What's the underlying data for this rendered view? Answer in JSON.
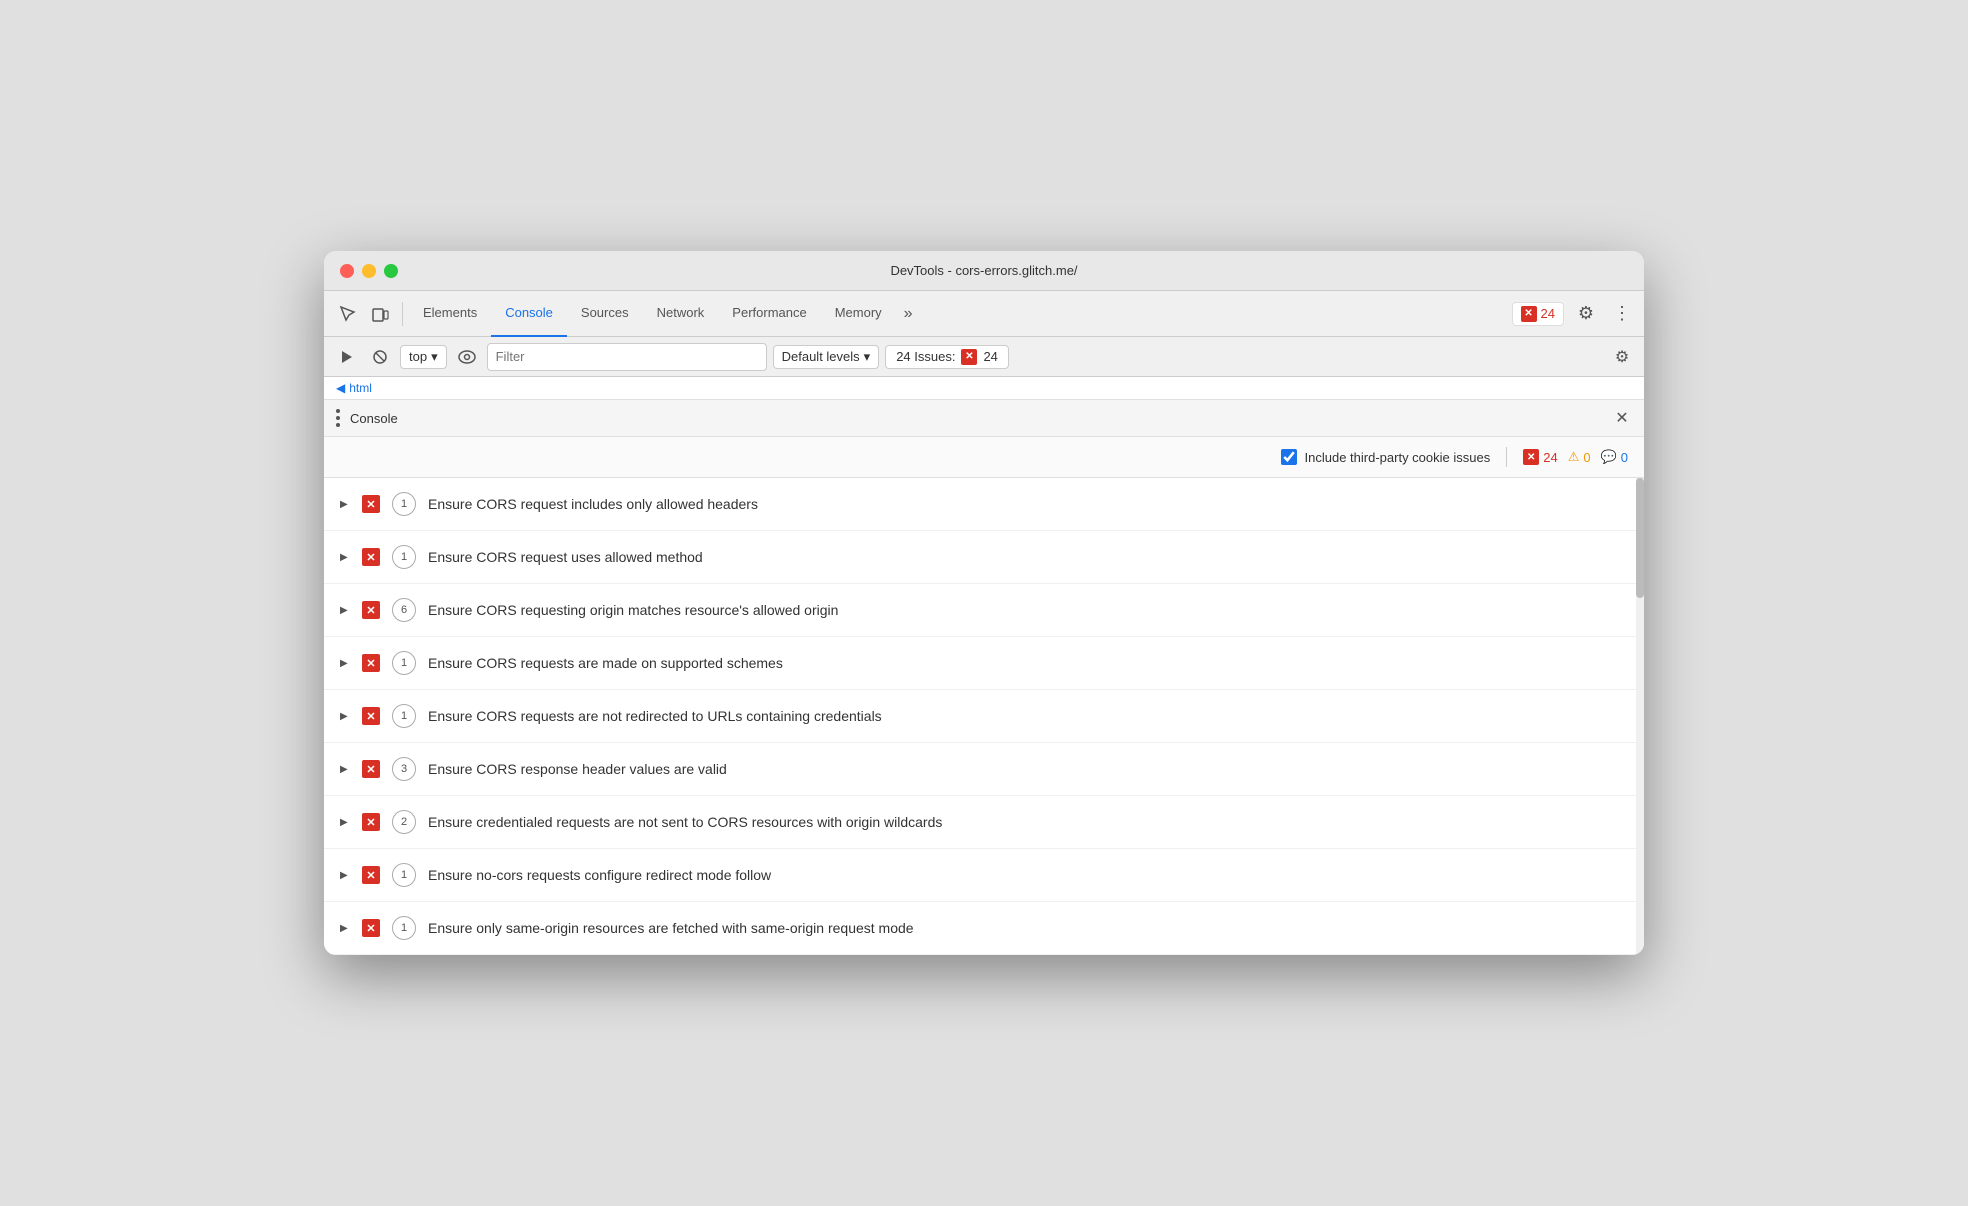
{
  "window": {
    "title": "DevTools - cors-errors.glitch.me/"
  },
  "toolbar": {
    "tabs": [
      {
        "id": "elements",
        "label": "Elements",
        "active": false
      },
      {
        "id": "console",
        "label": "Console",
        "active": true
      },
      {
        "id": "sources",
        "label": "Sources",
        "active": false
      },
      {
        "id": "network",
        "label": "Network",
        "active": false
      },
      {
        "id": "performance",
        "label": "Performance",
        "active": false
      },
      {
        "id": "memory",
        "label": "Memory",
        "active": false
      }
    ],
    "more_label": "»",
    "error_count": "24"
  },
  "console_toolbar": {
    "top_label": "top",
    "filter_placeholder": "Filter",
    "levels_label": "Default levels",
    "issues_label": "24 Issues:",
    "issues_count": "24"
  },
  "breadcrumb": {
    "text": "html"
  },
  "console_panel": {
    "title": "Console",
    "include_cookies_label": "Include third-party cookie issues",
    "counts": {
      "errors": "24",
      "warnings": "0",
      "info": "0"
    }
  },
  "issues": [
    {
      "id": 1,
      "count": 1,
      "text": "Ensure CORS request includes only allowed headers"
    },
    {
      "id": 2,
      "count": 1,
      "text": "Ensure CORS request uses allowed method"
    },
    {
      "id": 3,
      "count": 6,
      "text": "Ensure CORS requesting origin matches resource's allowed origin"
    },
    {
      "id": 4,
      "count": 1,
      "text": "Ensure CORS requests are made on supported schemes"
    },
    {
      "id": 5,
      "count": 1,
      "text": "Ensure CORS requests are not redirected to URLs containing credentials"
    },
    {
      "id": 6,
      "count": 3,
      "text": "Ensure CORS response header values are valid"
    },
    {
      "id": 7,
      "count": 2,
      "text": "Ensure credentialed requests are not sent to CORS resources with origin wildcards"
    },
    {
      "id": 8,
      "count": 1,
      "text": "Ensure no-cors requests configure redirect mode follow"
    },
    {
      "id": 9,
      "count": 1,
      "text": "Ensure only same-origin resources are fetched with same-origin request mode"
    }
  ]
}
